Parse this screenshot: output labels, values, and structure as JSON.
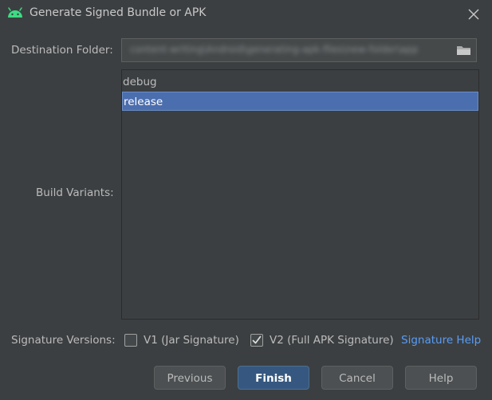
{
  "window": {
    "title": "Generate Signed Bundle or APK",
    "icon": "android-icon",
    "accent": "#4b6eaf"
  },
  "destination": {
    "label": "Destination Folder:",
    "value": "content-writing\\Android\\generating-apk-files\\new-folder\\app"
  },
  "build_variants": {
    "label": "Build Variants:",
    "items": [
      {
        "label": "debug",
        "selected": false
      },
      {
        "label": "release",
        "selected": true
      }
    ]
  },
  "signature": {
    "label": "Signature Versions:",
    "v1": {
      "label": "V1 (Jar Signature)",
      "checked": false
    },
    "v2": {
      "label": "V2 (Full APK Signature)",
      "checked": true
    },
    "help_link": "Signature Help"
  },
  "buttons": {
    "previous": "Previous",
    "finish": "Finish",
    "cancel": "Cancel",
    "help": "Help"
  }
}
